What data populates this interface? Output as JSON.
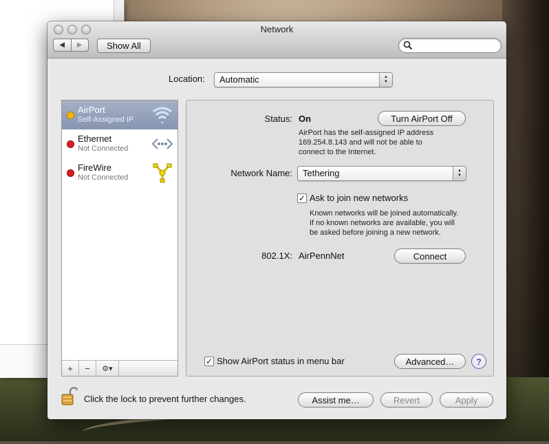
{
  "window": {
    "title": "Network"
  },
  "toolbar": {
    "back_label": "◀",
    "forward_label": "▶",
    "show_all_label": "Show All",
    "search_placeholder": ""
  },
  "location": {
    "label": "Location:",
    "value": "Automatic"
  },
  "services": [
    {
      "name": "AirPort",
      "status": "Self-Assigned IP",
      "dot_color": "#f5b800",
      "icon": "wifi-icon",
      "selected": true
    },
    {
      "name": "Ethernet",
      "status": "Not Connected",
      "dot_color": "#d81e1e",
      "icon": "ethernet-icon",
      "selected": false
    },
    {
      "name": "FireWire",
      "status": "Not Connected",
      "dot_color": "#d81e1e",
      "icon": "firewire-icon",
      "selected": false
    }
  ],
  "sidebar_controls": {
    "add": "+",
    "remove": "−",
    "gear": "⚙▾"
  },
  "detail": {
    "status_label": "Status:",
    "status_value": "On",
    "turn_off_label": "Turn AirPort Off",
    "status_desc_1": "AirPort has the self-assigned IP address",
    "status_desc_2": "169.254.8.143 and will not be able to",
    "status_desc_3": "connect to the Internet.",
    "network_name_label": "Network Name:",
    "network_name_value": "Tethering",
    "ask_join_label": "Ask to join new networks",
    "ask_join_checked": "✓",
    "ask_desc_1": "Known networks will be joined automatically.",
    "ask_desc_2": "If no known networks are available, you will",
    "ask_desc_3": "be asked before joining a new network.",
    "dot1x_label": "802.1X:",
    "dot1x_value": "AirPennNet",
    "connect_label": "Connect",
    "show_status_label": "Show AirPort status in menu bar",
    "show_status_checked": "✓",
    "advanced_label": "Advanced…",
    "help_label": "?"
  },
  "footer": {
    "lock_text": "Click the lock to prevent further changes.",
    "assist_label": "Assist me…",
    "revert_label": "Revert",
    "apply_label": "Apply"
  }
}
